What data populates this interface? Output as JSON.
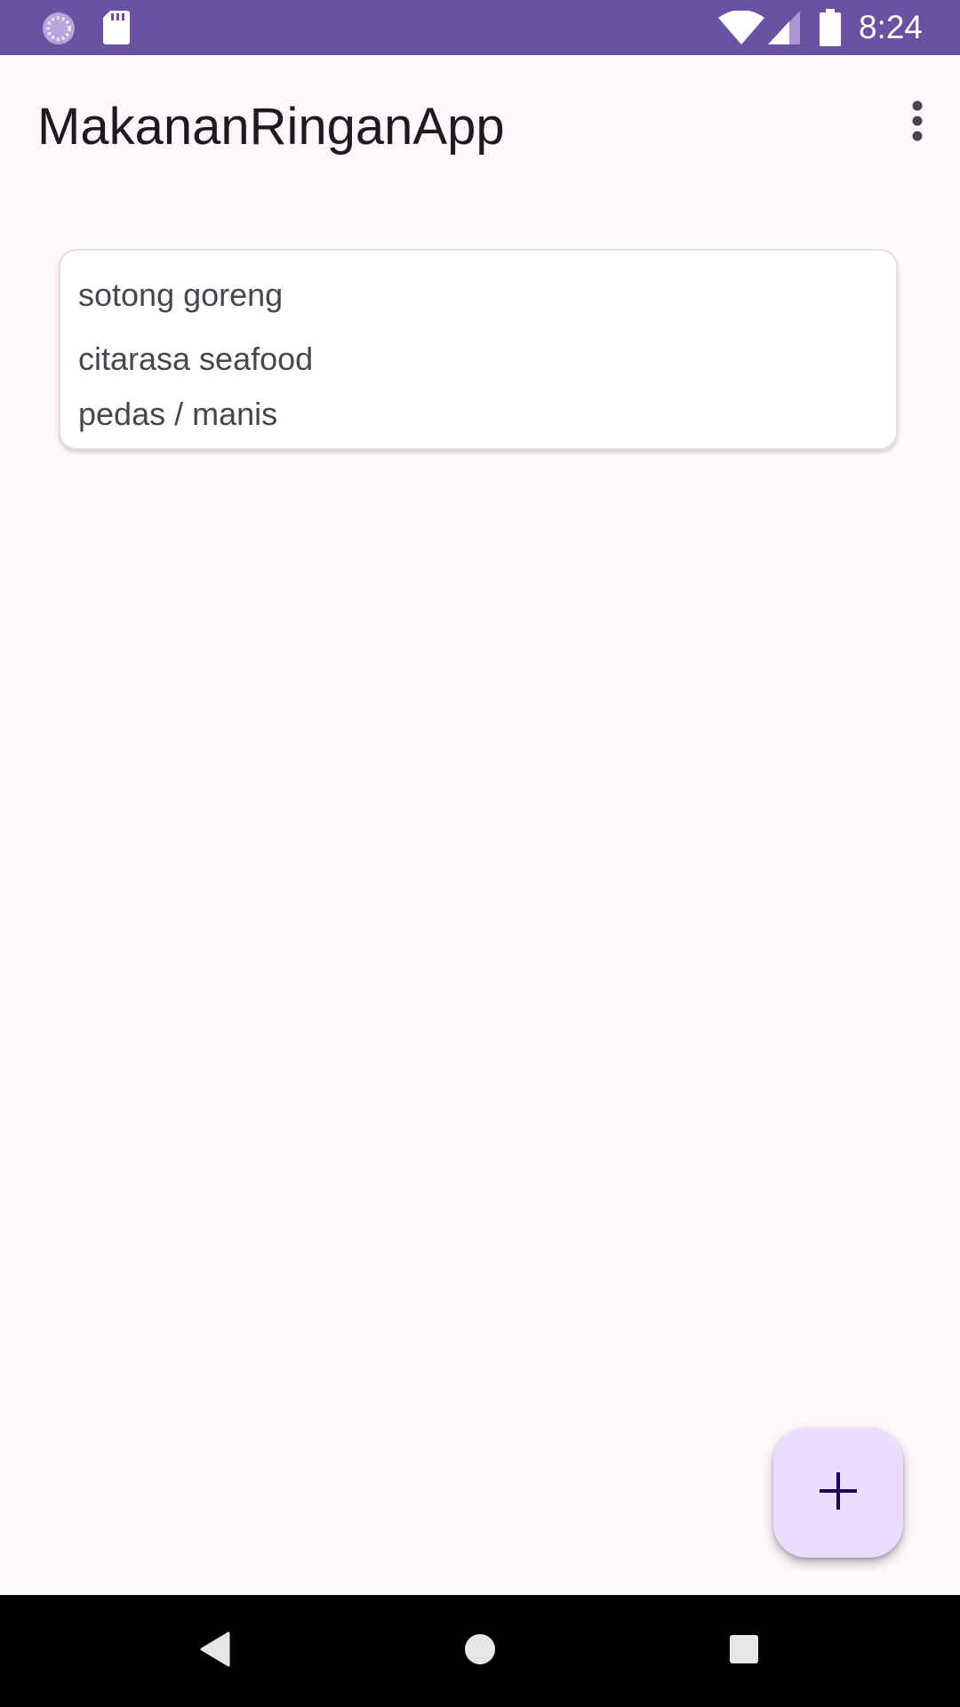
{
  "status_bar": {
    "time": "8:24",
    "left_icons": [
      "sync-icon",
      "sd-card-icon"
    ],
    "right_icons": [
      "wifi-icon",
      "cellular-signal-icon",
      "battery-icon"
    ],
    "background_color": "#6b51a2"
  },
  "app_bar": {
    "title": "MakananRinganApp",
    "menu_icon": "more-vert-icon"
  },
  "items": [
    {
      "name": "sotong goreng",
      "description": "citarasa seafood",
      "taste": "pedas / manis"
    }
  ],
  "fab": {
    "icon": "add-icon",
    "background_color": "#eaddff"
  },
  "nav_bar": {
    "buttons": [
      "back-icon",
      "home-icon",
      "recents-icon"
    ]
  },
  "colors": {
    "background": "#fef7fb",
    "primary": "#6b51a2",
    "text": "#1d1b20",
    "secondary_text": "#49454f"
  }
}
